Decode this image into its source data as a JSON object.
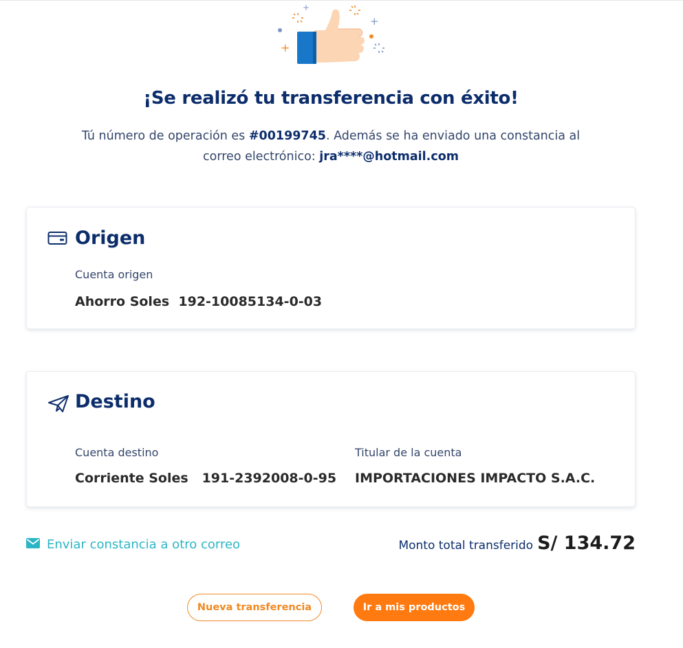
{
  "header": {
    "title": "¡Se realizó tu transferencia con éxito!",
    "subtitle_prefix": "Tú número de operación es ",
    "operation_number": "#00199745",
    "subtitle_middle": ". Además se ha enviado una constancia al correo electrónico: ",
    "email": "jra****@hotmail.com"
  },
  "origen": {
    "title": "Origen",
    "icon": "card-icon",
    "account_label": "Cuenta origen",
    "account_type": "Ahorro Soles",
    "account_number": "192-10085134-0-03"
  },
  "destino": {
    "title": "Destino",
    "icon": "paper-plane-icon",
    "account_label": "Cuenta destino",
    "account_type": "Corriente Soles",
    "account_number": "191-2392008-0-95",
    "holder_label": "Titular de la cuenta",
    "holder_name": "IMPORTACIONES IMPACTO S.A.C."
  },
  "actions": {
    "send_receipt_label": "Enviar constancia a otro correo",
    "total_label": "Monto total transferido",
    "total_amount": "S/ 134.72",
    "new_transfer_label": "Nueva transferencia",
    "products_label": "Ir a mis productos"
  },
  "colors": {
    "navy": "#0c2d6b",
    "teal": "#2bb5c5",
    "orange": "#ff7a10"
  }
}
